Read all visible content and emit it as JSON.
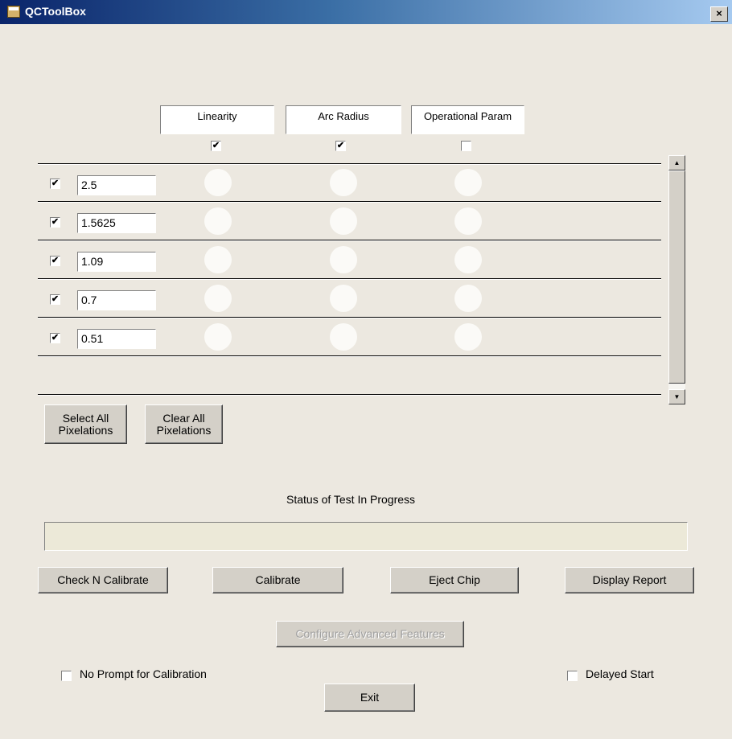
{
  "window": {
    "title": "QCToolBox",
    "close_glyph": "×"
  },
  "columns": [
    {
      "label": "Linearity",
      "checked": true
    },
    {
      "label": "Arc Radius",
      "checked": true
    },
    {
      "label": "Operational Param",
      "checked": false
    }
  ],
  "rows": [
    {
      "checked": true,
      "value": "2.5"
    },
    {
      "checked": true,
      "value": "1.5625"
    },
    {
      "checked": true,
      "value": "1.09"
    },
    {
      "checked": true,
      "value": "0.7"
    },
    {
      "checked": true,
      "value": "0.51"
    }
  ],
  "check_glyph": "✔",
  "scrollbar": {
    "up_glyph": "▲",
    "down_glyph": "▼"
  },
  "pixelation_buttons": {
    "select_all": "Select All Pixelations",
    "clear_all": "Clear All Pixelations"
  },
  "status": {
    "label": "Status of Test In Progress",
    "value": ""
  },
  "actions": {
    "check_n_calibrate": "Check N Calibrate",
    "calibrate": "Calibrate",
    "eject_chip": "Eject Chip",
    "display_report": "Display Report",
    "configure_advanced": "Configure Advanced Features",
    "exit": "Exit"
  },
  "options": {
    "no_prompt": {
      "label": "No Prompt for Calibration",
      "checked": false
    },
    "delayed_start": {
      "label": "Delayed Start",
      "checked": false
    }
  },
  "colors": {
    "window_bg": "#ece8e0",
    "button_face": "#d4d0c8",
    "lamp": "#fbfaf7"
  }
}
